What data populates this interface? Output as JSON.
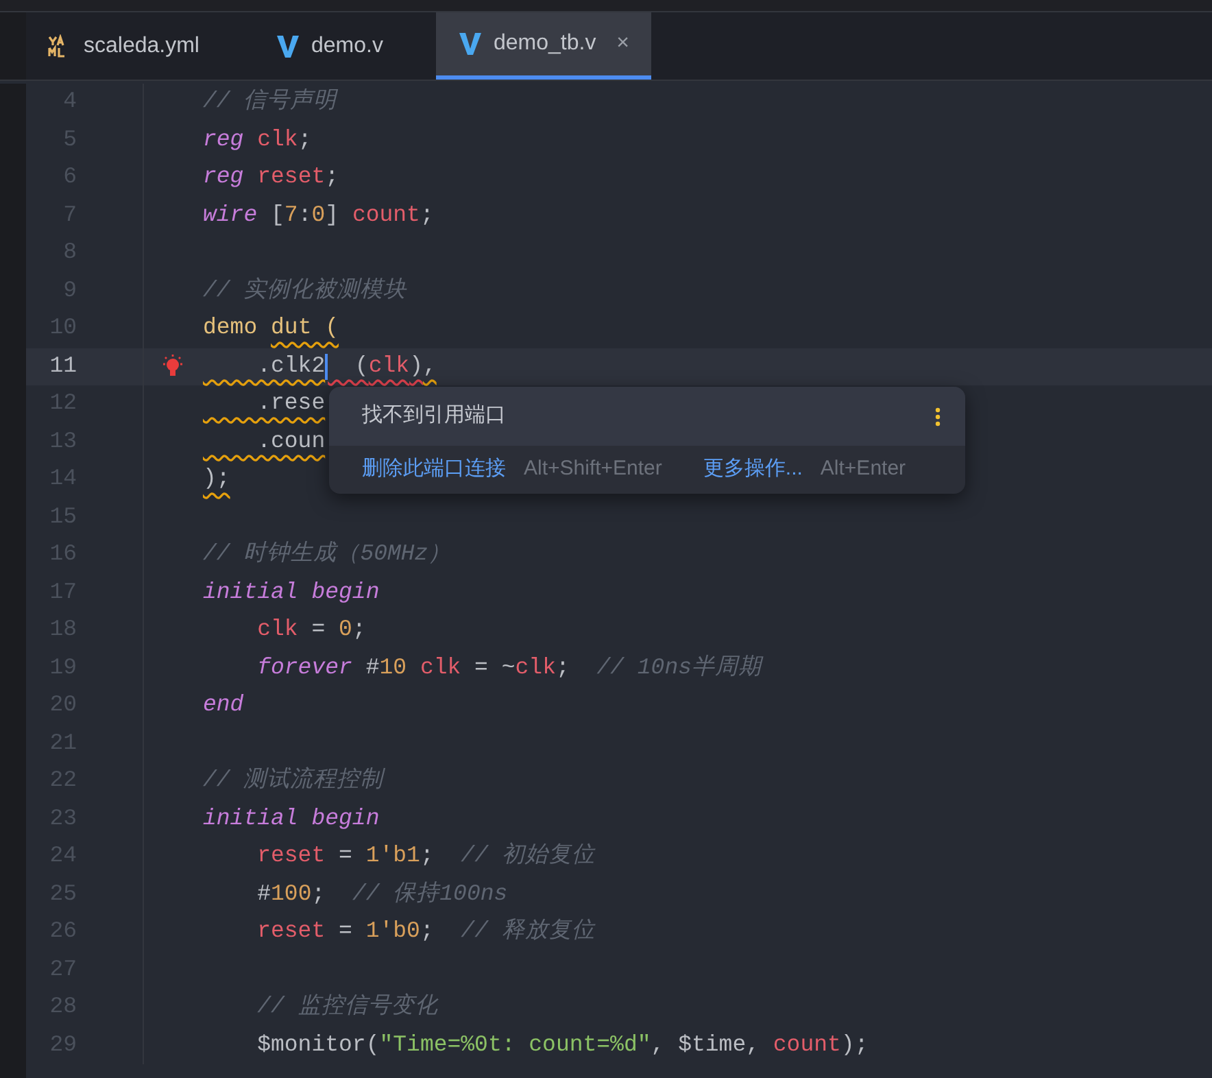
{
  "tabs": [
    {
      "label": "scaleda.yml",
      "kind": "yaml",
      "selected": false
    },
    {
      "label": "demo.v",
      "kind": "verilog",
      "selected": false
    },
    {
      "label": "demo_tb.v",
      "kind": "verilog",
      "selected": true,
      "close": "×"
    }
  ],
  "lines": [
    {
      "number": "4",
      "tokens": [
        {
          "text": "// 信号声明",
          "kind": "comment"
        }
      ]
    },
    {
      "number": "5",
      "tokens": [
        {
          "text": "reg",
          "kind": "keyword"
        },
        {
          "text": " clk",
          "kind": "variable"
        },
        {
          "text": ";",
          "kind": "plain"
        }
      ]
    },
    {
      "number": "6",
      "tokens": [
        {
          "text": "reg",
          "kind": "keyword"
        },
        {
          "text": " reset",
          "kind": "variable"
        },
        {
          "text": ";",
          "kind": "plain"
        }
      ]
    },
    {
      "number": "7",
      "tokens": [
        {
          "text": "wire",
          "kind": "keyword"
        },
        {
          "text": " [",
          "kind": "plain"
        },
        {
          "text": "7",
          "kind": "number"
        },
        {
          "text": ":",
          "kind": "plain"
        },
        {
          "text": "0",
          "kind": "number"
        },
        {
          "text": "] ",
          "kind": "plain"
        },
        {
          "text": "count",
          "kind": "variable"
        },
        {
          "text": ";",
          "kind": "plain"
        }
      ]
    },
    {
      "number": "8"
    },
    {
      "number": "9",
      "tokens": [
        {
          "text": "// 实例化被测模块",
          "kind": "comment"
        }
      ]
    },
    {
      "number": "10",
      "tokens": [
        {
          "text": "demo ",
          "kind": "module"
        },
        {
          "text": "dut (",
          "kind": "module",
          "warning": true
        }
      ]
    },
    {
      "number": "11",
      "current": true,
      "bulb": true,
      "tokens": [
        {
          "text": "    .clk2",
          "kind": "plain",
          "warning": true,
          "cursor": true
        },
        {
          "text": "  (",
          "kind": "plain",
          "error": true
        },
        {
          "text": "clk",
          "kind": "variable",
          "error": true
        },
        {
          "text": ")",
          "kind": "plain",
          "error": true
        },
        {
          "text": ",",
          "kind": "plain",
          "warning": true
        }
      ]
    },
    {
      "number": "12",
      "tokens": [
        {
          "text": "    .rese",
          "kind": "plain",
          "warning": true
        }
      ]
    },
    {
      "number": "13",
      "tokens": [
        {
          "text": "    .coun",
          "kind": "plain",
          "warning": true
        }
      ]
    },
    {
      "number": "14",
      "tokens": [
        {
          "text": ");",
          "kind": "plain",
          "warning": true
        }
      ]
    },
    {
      "number": "15"
    },
    {
      "number": "16",
      "tokens": [
        {
          "text": "// 时钟生成（50MHz）",
          "kind": "comment"
        }
      ]
    },
    {
      "number": "17",
      "tokens": [
        {
          "text": "initial begin",
          "kind": "keyword"
        }
      ]
    },
    {
      "number": "18",
      "tokens": [
        {
          "text": "    clk",
          "kind": "variable"
        },
        {
          "text": " = ",
          "kind": "plain"
        },
        {
          "text": "0",
          "kind": "number"
        },
        {
          "text": ";",
          "kind": "plain"
        }
      ]
    },
    {
      "number": "19",
      "tokens": [
        {
          "text": "    forever",
          "kind": "keyword"
        },
        {
          "text": " #",
          "kind": "plain"
        },
        {
          "text": "10",
          "kind": "number"
        },
        {
          "text": " clk",
          "kind": "variable"
        },
        {
          "text": " = ~",
          "kind": "plain"
        },
        {
          "text": "clk",
          "kind": "variable"
        },
        {
          "text": ";",
          "kind": "plain"
        },
        {
          "text": "  // 10ns半周期",
          "kind": "comment"
        }
      ]
    },
    {
      "number": "20",
      "tokens": [
        {
          "text": "end",
          "kind": "keyword"
        }
      ]
    },
    {
      "number": "21"
    },
    {
      "number": "22",
      "tokens": [
        {
          "text": "// 测试流程控制",
          "kind": "comment"
        }
      ]
    },
    {
      "number": "23",
      "tokens": [
        {
          "text": "initial begin",
          "kind": "keyword"
        }
      ]
    },
    {
      "number": "24",
      "tokens": [
        {
          "text": "    reset",
          "kind": "variable"
        },
        {
          "text": " = ",
          "kind": "plain"
        },
        {
          "text": "1'b1",
          "kind": "number"
        },
        {
          "text": ";",
          "kind": "plain"
        },
        {
          "text": "  // 初始复位",
          "kind": "comment"
        }
      ]
    },
    {
      "number": "25",
      "tokens": [
        {
          "text": "    #",
          "kind": "plain"
        },
        {
          "text": "100",
          "kind": "number"
        },
        {
          "text": ";",
          "kind": "plain"
        },
        {
          "text": "  // 保持100ns",
          "kind": "comment"
        }
      ]
    },
    {
      "number": "26",
      "tokens": [
        {
          "text": "    reset",
          "kind": "variable"
        },
        {
          "text": " = ",
          "kind": "plain"
        },
        {
          "text": "1'b0",
          "kind": "number"
        },
        {
          "text": ";",
          "kind": "plain"
        },
        {
          "text": "  // 释放复位",
          "kind": "comment"
        }
      ]
    },
    {
      "number": "27"
    },
    {
      "number": "28",
      "tokens": [
        {
          "text": "    // 监控信号变化",
          "kind": "comment"
        }
      ]
    },
    {
      "number": "29",
      "tokens": [
        {
          "text": "    $monitor(",
          "kind": "plain"
        },
        {
          "text": "\"Time=%0t: count=%d\"",
          "kind": "string"
        },
        {
          "text": ", $time, ",
          "kind": "plain"
        },
        {
          "text": "count",
          "kind": "variable"
        },
        {
          "text": ");",
          "kind": "plain"
        }
      ]
    }
  ],
  "popup": {
    "message": "找不到引用端口",
    "actions": [
      {
        "label": "删除此端口连接",
        "shortcut": "Alt+Shift+Enter"
      },
      {
        "label": "更多操作...",
        "shortcut": "Alt+Enter"
      }
    ]
  }
}
